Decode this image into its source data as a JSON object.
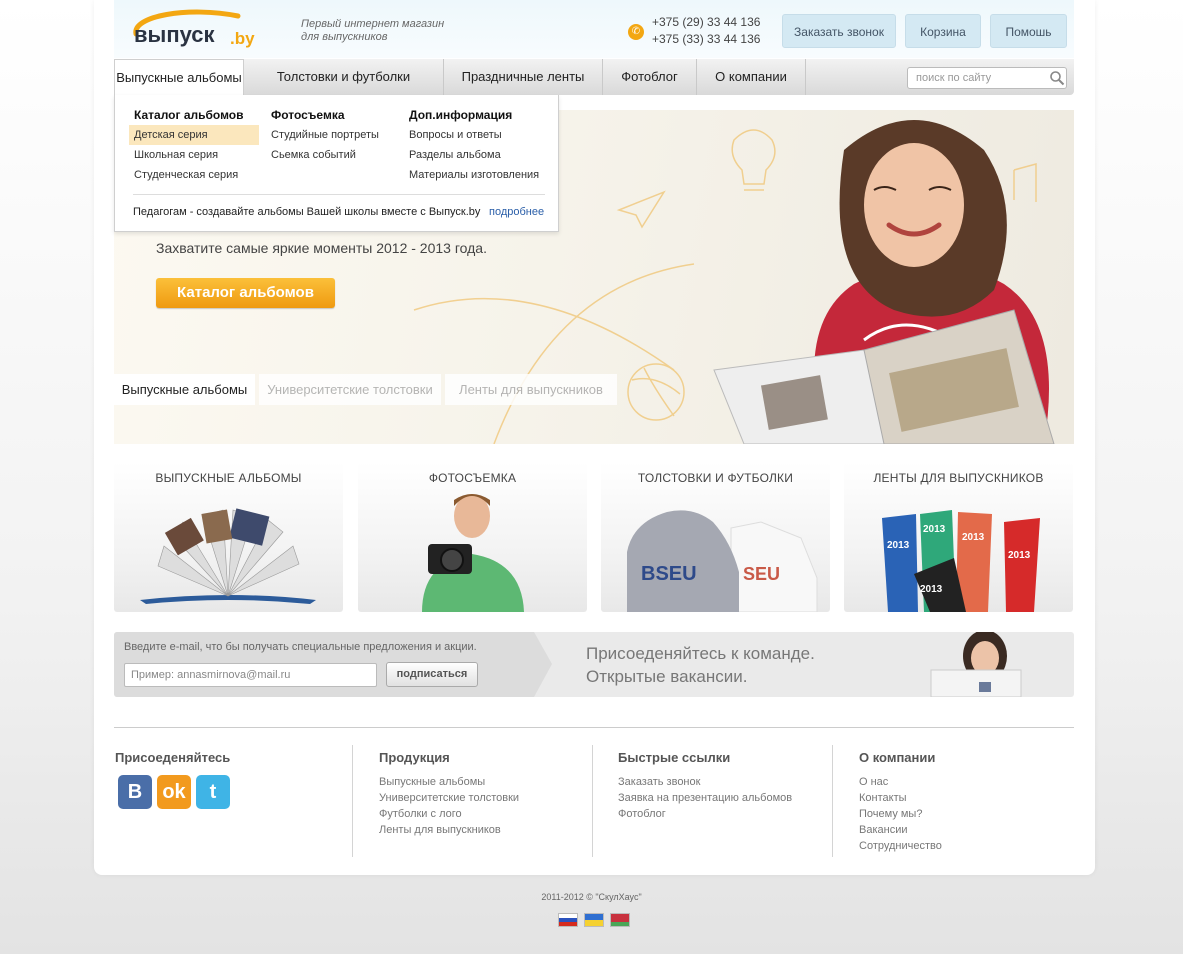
{
  "header": {
    "logo_text": "выпуск",
    "logo_suffix": ".by",
    "tagline_1": "Первый интернет магазин",
    "tagline_2": "для выпускников",
    "phone_1": "+375 (29) 33 44 136",
    "phone_2": "+375 (33) 33 44 136",
    "callback_label": "Заказать звонок",
    "cart_label": "Корзина",
    "help_label": "Помошь"
  },
  "nav": {
    "items": [
      {
        "label": "Выпускные альбомы"
      },
      {
        "label": "Толстовки и футболки"
      },
      {
        "label": "Праздничные ленты"
      },
      {
        "label": "Фотоблог"
      },
      {
        "label": "О компании"
      }
    ],
    "search_placeholder": "поиск по сайту"
  },
  "dropdown": {
    "columns": [
      {
        "title": "Каталог альбомов",
        "items": [
          "Детская серия",
          "Школьная серия",
          "Студенческая серия"
        ]
      },
      {
        "title": "Фотосъемка",
        "items": [
          "Студийные портреты",
          "Сьемка событий"
        ]
      },
      {
        "title": "Доп.информация",
        "items": [
          "Вопросы и ответы",
          "Разделы альбома",
          "Материалы изготовления"
        ]
      }
    ],
    "footer_text": "Педагогам - создавайте альбомы Вашей школы вместе с Выпуск.by",
    "more_label": "подробнее"
  },
  "hero": {
    "subtitle": "Захватите самые яркие моменты 2012 - 2013 года.",
    "button_label": "Каталог альбомов",
    "tabs": [
      "Выпускные альбомы",
      "Университетские толстовки",
      "Ленты для выпускников"
    ]
  },
  "categories": [
    {
      "title": "ВЫПУСКНЫЕ АЛЬБОМЫ"
    },
    {
      "title": "ФОТОСЪЕМКА"
    },
    {
      "title": "ТОЛСТОВКИ И ФУТБОЛКИ"
    },
    {
      "title": "ЛЕНТЫ ДЛЯ ВЫПУСКНИКОВ"
    }
  ],
  "subscribe": {
    "hint": "Введите e-mail, что бы получать специальные предложения и акции.",
    "placeholder": "Пример: annasmirnova@mail.ru",
    "button_label": "подписаться",
    "join_line_1": "Присоеденяйтесь к команде.",
    "join_line_2": "Открытые вакансии."
  },
  "footer": {
    "join_title": "Присоеденяйтесь",
    "products_title": "Продукция",
    "products": [
      "Выпускные альбомы",
      "Университетские толстовки",
      "Футболки с лого",
      "Ленты для выпускников"
    ],
    "links_title": "Быстрые ссылки",
    "links": [
      "Заказать звонок",
      "Заявка на презентацию альбомов",
      "Фотоблог"
    ],
    "company_title": "О компании",
    "company": [
      "О нас",
      "Контакты",
      "Почему мы?",
      "Вакансии",
      "Сотрудничество"
    ],
    "copyright": "2011-2012 ©  \"СкулХаус\""
  },
  "colors": {
    "accent": "#f3a712",
    "header_bg": "#eef8fc",
    "nav_bg": "#d9d9d9"
  }
}
